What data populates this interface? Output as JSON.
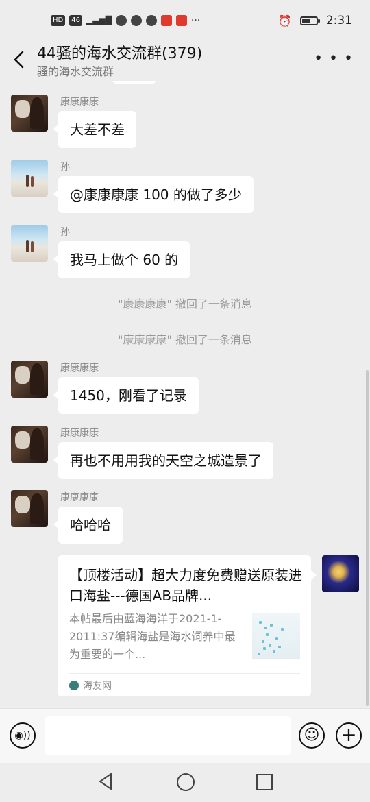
{
  "status_bar": {
    "network_label": "HD",
    "network_type": "46",
    "time": "2:31",
    "battery_level": 0.55
  },
  "header": {
    "title": "44骚的海水交流群(379)",
    "subtitle": "骚的海水交流群"
  },
  "messages": [
    {
      "sender": "康康康康",
      "text": "大差不差",
      "avatar": "kang"
    },
    {
      "sender": "孙",
      "text": "@康康康康  100 的做了多少",
      "avatar": "sun"
    },
    {
      "sender": "孙",
      "text": "我马上做个 60 的",
      "avatar": "sun"
    },
    {
      "system": "\"康康康康\" 撤回了一条消息"
    },
    {
      "system": "\"康康康康\" 撤回了一条消息"
    },
    {
      "sender": "康康康康",
      "text": "1450，刚看了记录",
      "avatar": "kang"
    },
    {
      "sender": "康康康康",
      "text": "再也不用用我的天空之城造景了",
      "avatar": "kang"
    },
    {
      "sender": "康康康康",
      "text": "哈哈哈",
      "avatar": "kang"
    }
  ],
  "link_card": {
    "title": "【顶楼活动】超大力度免费赠送原装进口海盐---德国AB品牌...",
    "description": "本帖最后由蓝海海洋于2021-1-2011:37编辑海盐是海水饲养中最为重要的一个...",
    "source": "海友网"
  },
  "input": {
    "value": "",
    "placeholder": ""
  },
  "icons": {
    "back": "chevron-left-icon",
    "more": "more-dots-icon",
    "voice": "voice-icon",
    "emoji": "emoji-icon",
    "plus": "plus-icon"
  }
}
